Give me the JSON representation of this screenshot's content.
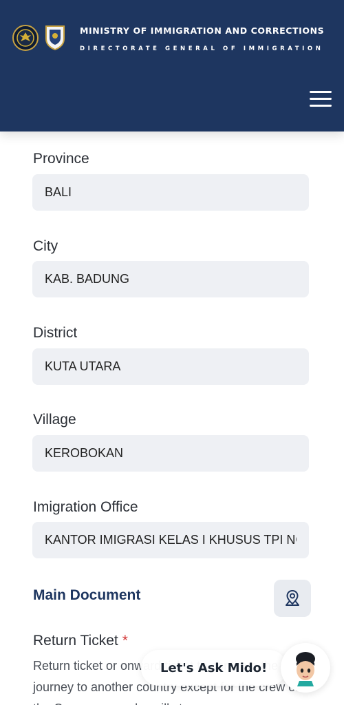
{
  "header": {
    "ministry": "MINISTRY OF IMMIGRATION AND CORRECTIONS",
    "directorate": "DIRECTORATE GENERAL OF IMMIGRATION",
    "logo_left_icon": "garuda-emblem-icon",
    "logo_right_icon": "immigration-shield-icon",
    "menu_icon": "hamburger-menu-icon",
    "background": "#1e3660"
  },
  "form": {
    "province": {
      "label": "Province",
      "value": "BALI"
    },
    "city": {
      "label": "City",
      "value": "KAB. BADUNG"
    },
    "district": {
      "label": "District",
      "value": "KUTA UTARA"
    },
    "village": {
      "label": "Village",
      "value": "KEROBOKAN"
    },
    "office": {
      "label": "Imigration Office",
      "value": "KANTOR IMIGRASI KELAS I KHUSUS TPI NGURAH RAI"
    }
  },
  "main_document": {
    "title": "Main Document",
    "map_icon": "map-pin-icon",
    "return_ticket": {
      "label": "Return Ticket",
      "required_mark": "*",
      "description_visible": "Return ticket or onward ticket to continue the journey to another country except for the crew of the Conveyance who will stop"
    }
  },
  "assistant": {
    "label": "Let's Ask Mido!",
    "avatar_icon": "mido-avatar-icon"
  },
  "colors": {
    "primary": "#1e3660",
    "field_bg": "#eef0f4",
    "required": "#d33a3a"
  }
}
